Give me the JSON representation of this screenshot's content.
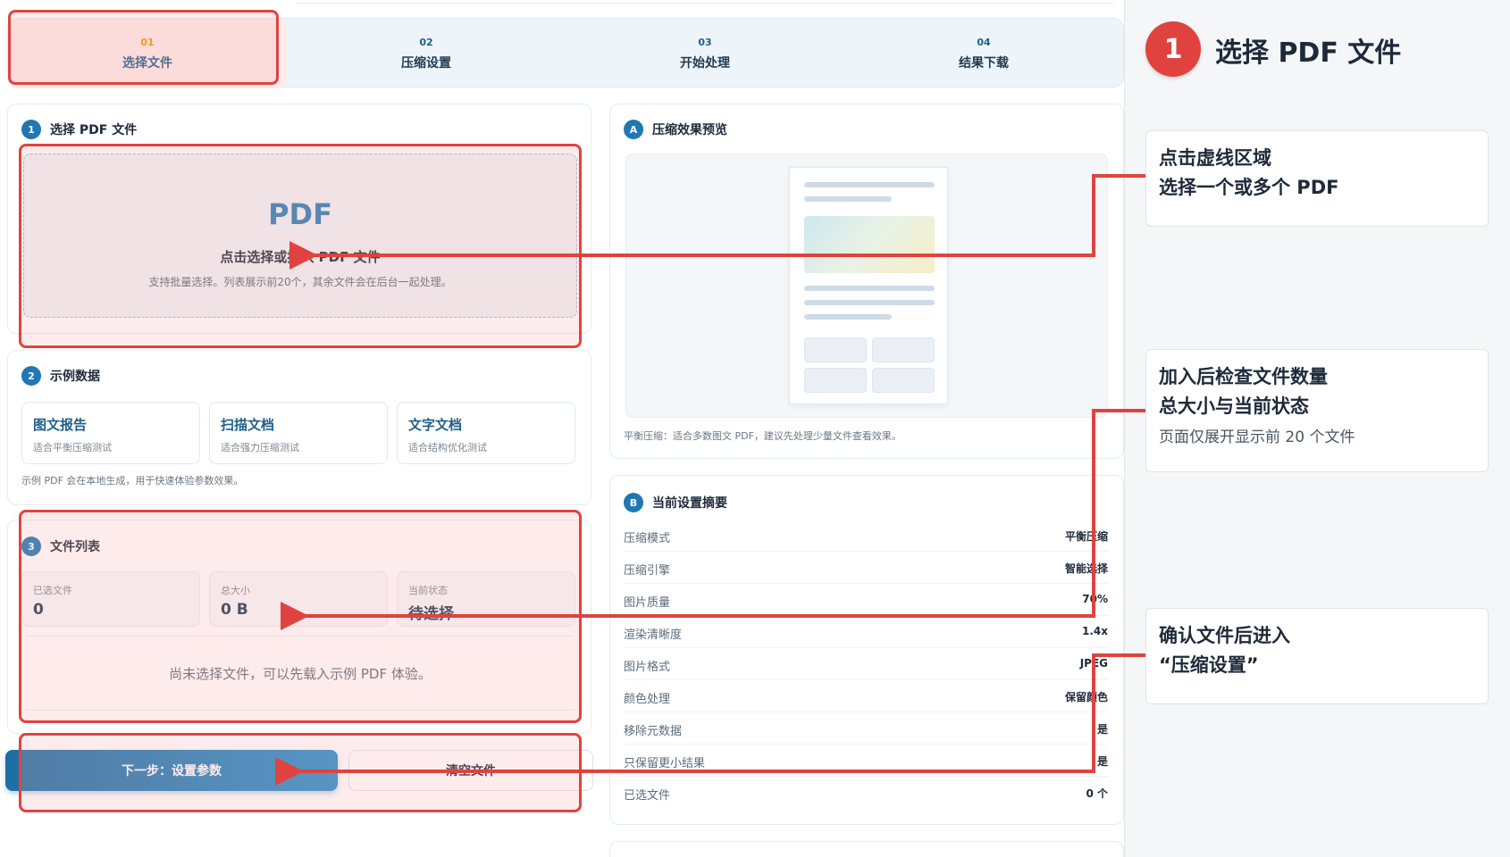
{
  "steps": [
    {
      "num": "01",
      "label": "选择文件"
    },
    {
      "num": "02",
      "label": "压缩设置"
    },
    {
      "num": "03",
      "label": "开始处理"
    },
    {
      "num": "04",
      "label": "结果下载"
    }
  ],
  "upload": {
    "badge": "1",
    "title": "选择 PDF 文件",
    "pdf_text": "PDF",
    "main_text": "点击选择或拖入 PDF 文件",
    "sub_text": "支持批量选择。列表展示前20个，其余文件会在后台一起处理。"
  },
  "samples": {
    "badge": "2",
    "title": "示例数据",
    "items": [
      {
        "title": "图文报告",
        "desc": "适合平衡压缩测试"
      },
      {
        "title": "扫描文档",
        "desc": "适合强力压缩测试"
      },
      {
        "title": "文字文档",
        "desc": "适合结构优化测试"
      }
    ],
    "note": "示例 PDF 会在本地生成，用于快速体验参数效果。"
  },
  "files": {
    "badge": "3",
    "title": "文件列表",
    "stats": [
      {
        "label": "已选文件",
        "value": "0"
      },
      {
        "label": "总大小",
        "value": "0 B"
      },
      {
        "label": "当前状态",
        "value": "待选择"
      }
    ],
    "empty_text": "尚未选择文件，可以先载入示例 PDF 体验。"
  },
  "actions": {
    "next": "下一步：设置参数",
    "clear": "清空文件"
  },
  "preview": {
    "badge": "A",
    "title": "压缩效果预览",
    "note": "平衡压缩：适合多数图文 PDF，建议先处理少量文件查看效果。"
  },
  "summary": {
    "badge": "B",
    "title": "当前设置摘要",
    "rows": [
      {
        "key": "压缩模式",
        "value": "平衡压缩"
      },
      {
        "key": "压缩引擎",
        "value": "智能选择"
      },
      {
        "key": "图片质量",
        "value": "70%"
      },
      {
        "key": "渲染清晰度",
        "value": "1.4x"
      },
      {
        "key": "图片格式",
        "value": "JPEG"
      },
      {
        "key": "颜色处理",
        "value": "保留颜色"
      },
      {
        "key": "移除元数据",
        "value": "是"
      },
      {
        "key": "只保留更小结果",
        "value": "是"
      },
      {
        "key": "已选文件",
        "value": "0 个"
      }
    ]
  },
  "annotation": {
    "step_number": "1",
    "title": "选择 PDF 文件",
    "notes": [
      {
        "line1": "点击虚线区域",
        "line2": "选择一个或多个 PDF"
      },
      {
        "line1": "加入后检查文件数量",
        "line2": "总大小与当前状态",
        "line3": "页面仅展开显示前 20 个文件"
      },
      {
        "line1": "确认文件后进入",
        "line2": "“压缩设置”"
      }
    ]
  },
  "colors": {
    "accent": "#1f77b4",
    "annotation_red": "#e0433f",
    "active_step_num": "#e59a00"
  }
}
